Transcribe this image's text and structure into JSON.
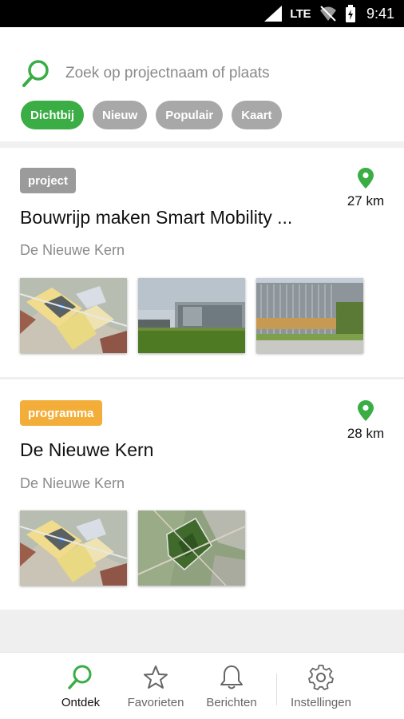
{
  "status_bar": {
    "network": "LTE",
    "time": "9:41"
  },
  "search": {
    "placeholder": "Zoek op projectnaam of plaats"
  },
  "filters": [
    {
      "label": "Dichtbij",
      "active": true
    },
    {
      "label": "Nieuw",
      "active": false
    },
    {
      "label": "Populair",
      "active": false
    },
    {
      "label": "Kaart",
      "active": false
    }
  ],
  "cards": [
    {
      "tag": "project",
      "title": "Bouwrijp maken Smart Mobility ...",
      "place": "De Nieuwe Kern",
      "distance": "27 km",
      "images": [
        "site-map-thumbnail",
        "office-buildings-photo",
        "glass-building-photo"
      ]
    },
    {
      "tag": "programma",
      "title": "De Nieuwe Kern",
      "place": "De Nieuwe Kern",
      "distance": "28 km",
      "images": [
        "site-map-thumbnail",
        "aerial-area-map"
      ]
    }
  ],
  "nav": [
    {
      "label": "Ontdek",
      "icon": "search-icon",
      "active": true
    },
    {
      "label": "Favorieten",
      "icon": "star-icon",
      "active": false
    },
    {
      "label": "Berichten",
      "icon": "bell-icon",
      "active": false
    },
    {
      "label": "Instellingen",
      "icon": "gear-icon",
      "active": false
    }
  ],
  "colors": {
    "accent": "#3aad44",
    "tag_project": "#9b9b9b",
    "tag_programma": "#f3ae3a"
  }
}
